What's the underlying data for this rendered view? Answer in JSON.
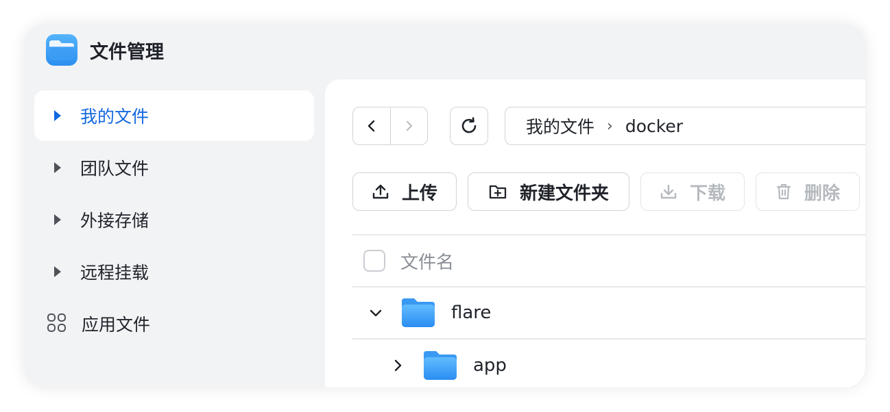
{
  "app": {
    "title": "文件管理",
    "icon": "folder-app-icon",
    "accent": "#1468e0"
  },
  "sidebar": {
    "items": [
      {
        "label": "我的文件",
        "icon": "caret-right-icon",
        "active": true
      },
      {
        "label": "团队文件",
        "icon": "caret-right-icon"
      },
      {
        "label": "外接存储",
        "icon": "caret-right-icon"
      },
      {
        "label": "远程挂载",
        "icon": "caret-right-icon"
      },
      {
        "label": "应用文件",
        "icon": "apps-grid-icon"
      }
    ]
  },
  "toolbar": {
    "back_icon": "chevron-left-icon",
    "forward_icon": "chevron-right-icon",
    "refresh_icon": "refresh-icon",
    "breadcrumb": [
      "我的文件",
      "docker"
    ]
  },
  "actions": {
    "upload": "上传",
    "new_folder": "新建文件夹",
    "download": "下载",
    "delete": "删除"
  },
  "table": {
    "header": "文件名",
    "rows": [
      {
        "name": "flare",
        "expanded": true,
        "level": 0
      },
      {
        "name": "app",
        "expanded": false,
        "level": 1
      }
    ]
  }
}
